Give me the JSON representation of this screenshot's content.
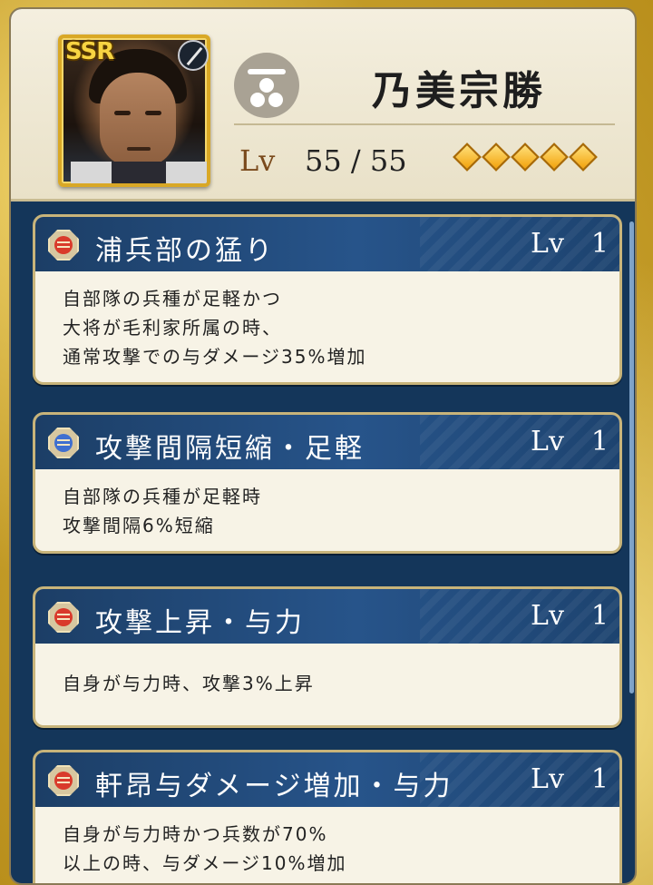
{
  "character": {
    "rarity": "SSR",
    "name": "乃美宗勝",
    "level_label": "Lv",
    "level_current": "55",
    "level_max": "55",
    "level_text": "55 /  55",
    "star_count": 5,
    "weapon_icon": "spear-icon",
    "crest_icon": "family-crest-icon"
  },
  "skills": [
    {
      "name": "浦兵部の猛り",
      "level_label": "Lv",
      "level": "1",
      "icon": "skill-red-icon",
      "description": [
        "自部隊の兵種が足軽かつ",
        "大将が毛利家所属の時、",
        "通常攻撃での与ダメージ35%増加"
      ]
    },
    {
      "name": "攻撃間隔短縮・足軽",
      "level_label": "Lv",
      "level": "1",
      "icon": "skill-blue-icon",
      "description": [
        "自部隊の兵種が足軽時",
        "攻撃間隔6%短縮"
      ]
    },
    {
      "name": "攻撃上昇・与力",
      "level_label": "Lv",
      "level": "1",
      "icon": "skill-red-icon",
      "description": [
        "自身が与力時、攻撃3%上昇"
      ]
    },
    {
      "name": "軒昂与ダメージ増加・与力",
      "level_label": "Lv",
      "level": "1",
      "icon": "skill-red-icon",
      "description": [
        "自身が与力時かつ兵数が70%",
        "以上の時、与ダメージ10%増加"
      ]
    }
  ],
  "colors": {
    "card_header": "#27548a",
    "gold_frame": "#d9a826",
    "level_label": "#7a4a1c"
  }
}
